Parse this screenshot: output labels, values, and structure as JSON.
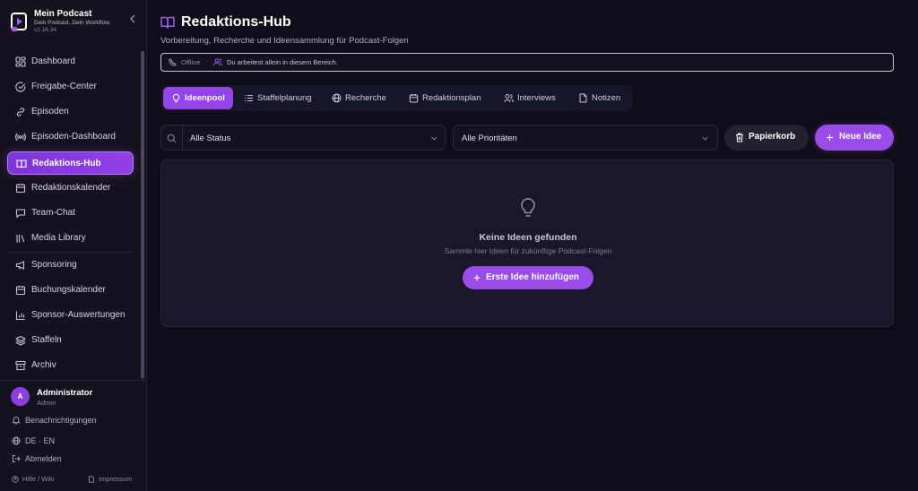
{
  "brand": {
    "title": "Mein Podcast",
    "tagline": "Dein Podcast. Dein Workflow.",
    "version": "v2.16.34"
  },
  "sidebar": {
    "items": [
      {
        "label": "Dashboard",
        "icon": "dashboard-icon"
      },
      {
        "label": "Freigabe-Center",
        "icon": "check-circle-icon"
      },
      {
        "label": "Episoden",
        "icon": "link-icon"
      },
      {
        "label": "Episoden-Dashboard",
        "icon": "broadcast-icon"
      },
      {
        "label": "Redaktions-Hub",
        "icon": "book-icon",
        "active": true
      },
      {
        "label": "Redaktionskalender",
        "icon": "calendar-icon"
      },
      {
        "label": "Team-Chat",
        "icon": "chat-icon"
      },
      {
        "label": "Media Library",
        "icon": "library-icon"
      },
      {
        "label": "Sponsoring",
        "icon": "megaphone-icon"
      },
      {
        "label": "Buchungskalender",
        "icon": "calendar-icon"
      },
      {
        "label": "Sponsor-Auswertungen",
        "icon": "bar-chart-icon"
      },
      {
        "label": "Staffeln",
        "icon": "layers-icon"
      },
      {
        "label": "Archiv",
        "icon": "archive-icon"
      }
    ],
    "user": {
      "initial": "A",
      "name": "Administrator",
      "role": "Admin"
    },
    "notifications_label": "Benachrichtigungen",
    "language_label": "DE · EN",
    "logout_label": "Abmelden",
    "help_label": "Hilfe / Wiki",
    "imprint_label": "Impressum"
  },
  "header": {
    "title": "Redaktions-Hub",
    "subtitle": "Vorbereitung, Recherche und Ideensammlung für Podcast-Folgen"
  },
  "status": {
    "offline_label": "Offline",
    "separator": "·",
    "message": "Du arbeitest allein in diesem Bereich."
  },
  "tabs": [
    {
      "label": "Ideenpool",
      "icon": "lightbulb-icon",
      "active": true
    },
    {
      "label": "Staffelplanung",
      "icon": "list-icon"
    },
    {
      "label": "Recherche",
      "icon": "globe-icon"
    },
    {
      "label": "Redaktionsplan",
      "icon": "calendar-icon"
    },
    {
      "label": "Interviews",
      "icon": "users-icon"
    },
    {
      "label": "Notizen",
      "icon": "file-icon"
    }
  ],
  "filters": {
    "status_value": "Alle Status",
    "priority_value": "Alle Prioritäten"
  },
  "actions": {
    "trash_label": "Papierkorb",
    "new_label": "Neue Idee"
  },
  "empty_state": {
    "title": "Keine Ideen gefunden",
    "subtitle": "Sammle hier Ideen für zukünftige Podcast-Folgen",
    "button_label": "Erste Idee hinzufügen"
  },
  "colors": {
    "accent": "#9a4ce8",
    "background": "#0f0d17",
    "sidebar": "#14121d"
  }
}
